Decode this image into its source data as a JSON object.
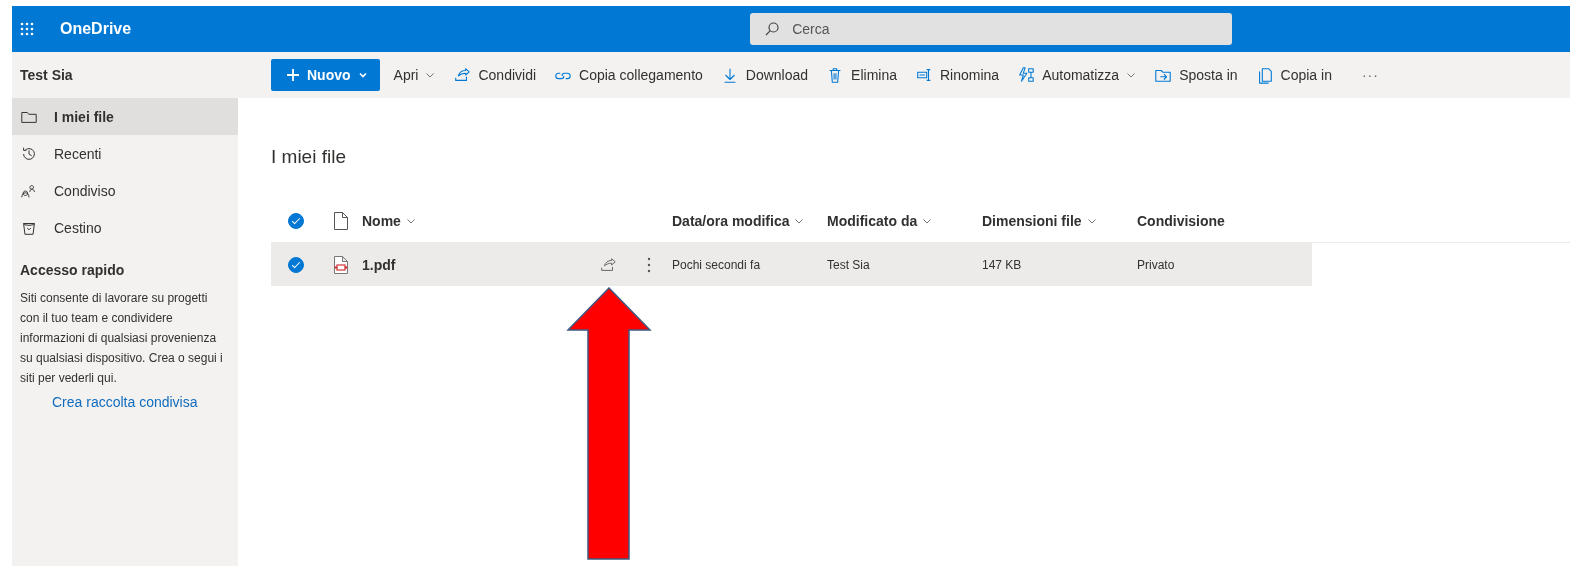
{
  "app": {
    "name": "OneDrive"
  },
  "search": {
    "placeholder": "Cerca"
  },
  "account": "Test Sia",
  "toolbar": {
    "new_button": "Nuovo",
    "items": [
      {
        "label": "Apri",
        "dropdown": true
      },
      {
        "label": "Condividi",
        "dropdown": false
      },
      {
        "label": "Copia collegamento",
        "dropdown": false
      },
      {
        "label": "Download",
        "dropdown": false
      },
      {
        "label": "Elimina",
        "dropdown": false
      },
      {
        "label": "Rinomina",
        "dropdown": false
      },
      {
        "label": "Automatizza",
        "dropdown": true
      },
      {
        "label": "Sposta in",
        "dropdown": false
      },
      {
        "label": "Copia in",
        "dropdown": false
      }
    ],
    "more": "···"
  },
  "sidebar": {
    "items": [
      {
        "label": "I miei file",
        "selected": true
      },
      {
        "label": "Recenti",
        "selected": false
      },
      {
        "label": "Condiviso",
        "selected": false
      },
      {
        "label": "Cestino",
        "selected": false
      }
    ]
  },
  "quick_access": {
    "title": "Accesso rapido",
    "text": "Siti consente di lavorare su progetti con il tuo team e condividere informazioni di qualsiasi provenienza su qualsiasi dispositivo. Crea o segui i siti per vederli qui.",
    "link": "Crea raccolta condivisa"
  },
  "page_title": "I miei file",
  "table": {
    "all_selected": true,
    "columns": [
      {
        "label": "Nome",
        "sortable": true
      },
      {
        "label": "Data/ora modifica",
        "sortable": true
      },
      {
        "label": "Modificato da",
        "sortable": true
      },
      {
        "label": "Dimensioni file",
        "sortable": true
      },
      {
        "label": "Condivisione",
        "sortable": false
      }
    ],
    "rows": [
      {
        "selected": true,
        "name": "1.pdf",
        "modified": "Pochi secondi fa",
        "modified_by": "Test Sia",
        "size": "147 KB",
        "sharing": "Privato"
      }
    ]
  }
}
